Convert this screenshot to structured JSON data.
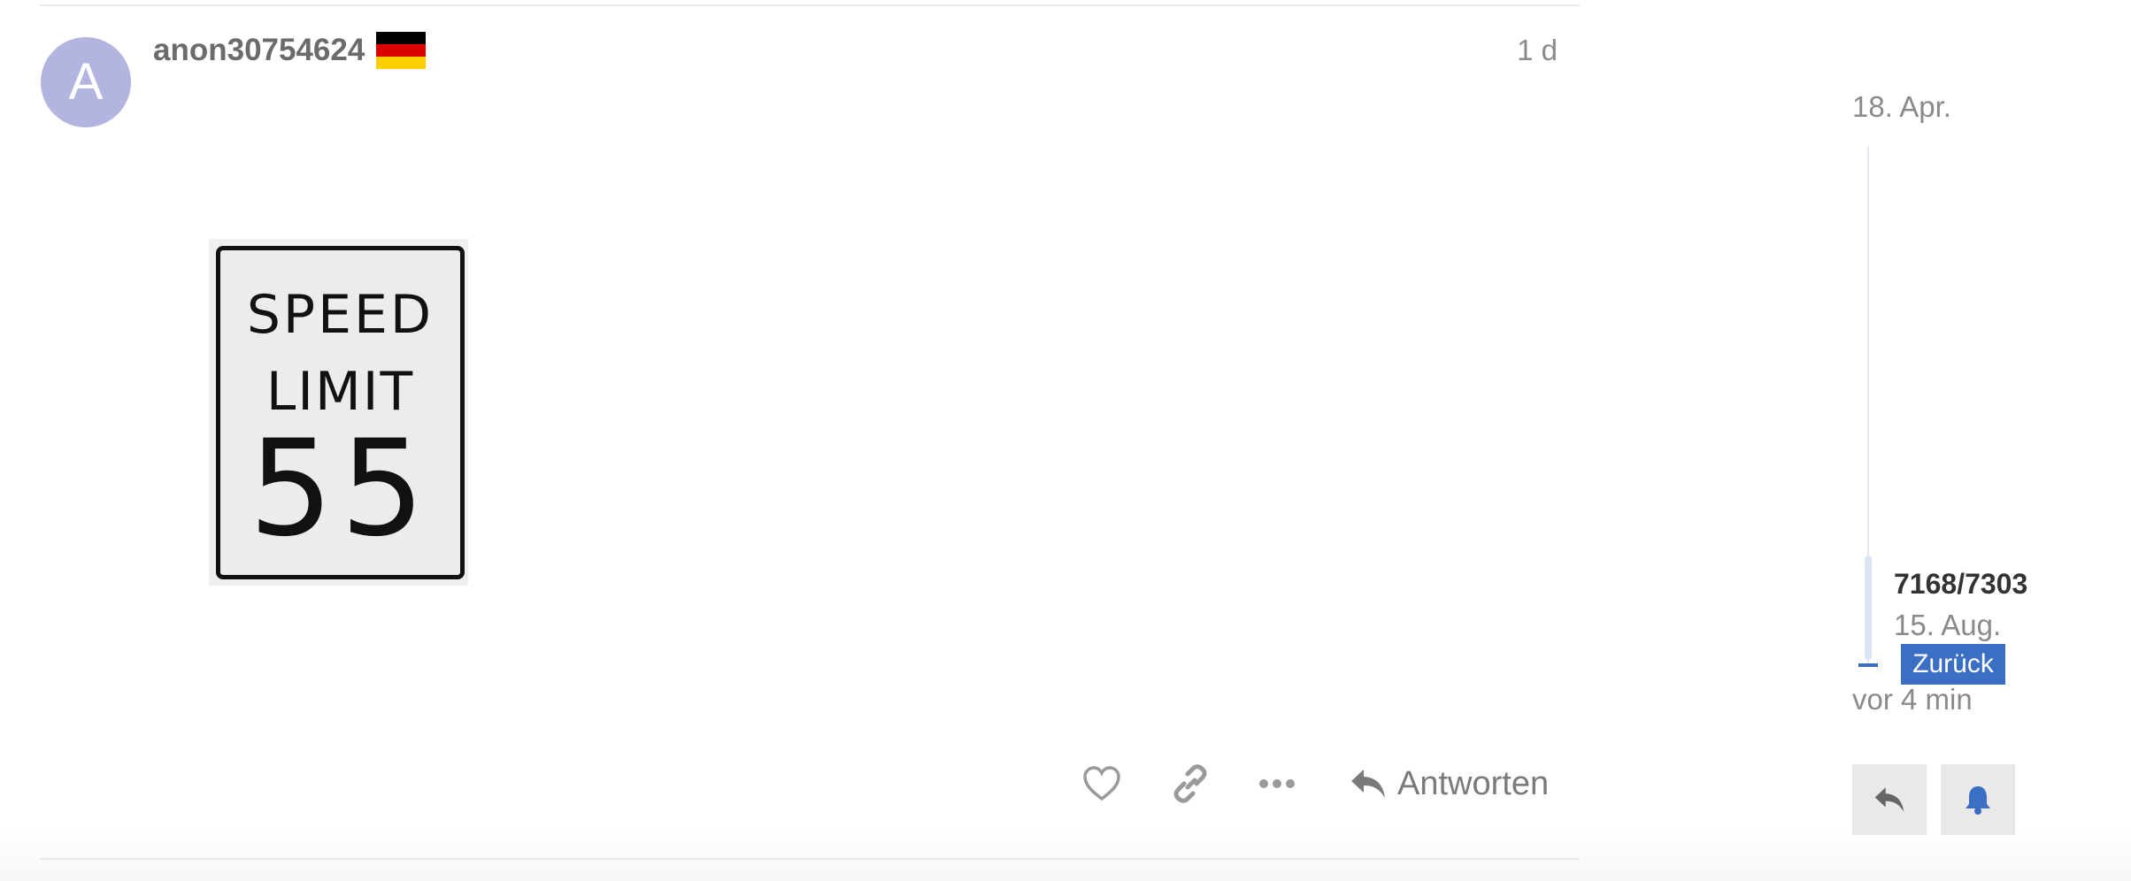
{
  "post": {
    "avatar_letter": "A",
    "username": "anon30754624",
    "flag_icon": "flag-germany-icon",
    "flag_colors": [
      "#000000",
      "#dd0000",
      "#ffce00"
    ],
    "date": "1 d",
    "image": {
      "line1": "SPEED",
      "line2": "LIMIT",
      "line3": "55"
    },
    "actions": {
      "like_icon": "heart-icon",
      "link_icon": "link-icon",
      "more_icon": "more-icon",
      "reply_icon": "reply-icon",
      "reply_label": "Antworten"
    }
  },
  "timeline": {
    "start_date": "18. Apr.",
    "position": "7168/7303",
    "current_date": "15. Aug.",
    "back_label": "Zurück",
    "last_activity": "vor 4 min",
    "reply_icon": "reply-icon",
    "bell_icon": "bell-icon",
    "accent": "#3b6fc4"
  }
}
